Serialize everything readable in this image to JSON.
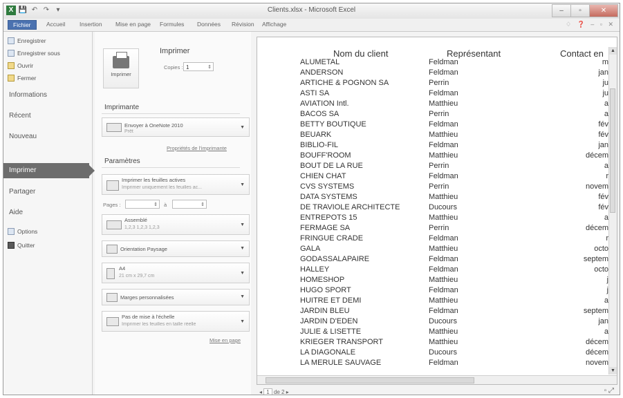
{
  "window": {
    "title": "Clients.xlsx - Microsoft Excel",
    "qat": [
      "X",
      "💾",
      "↶",
      "↷",
      "▾"
    ],
    "controls": [
      "–",
      "▫",
      "✕"
    ]
  },
  "ribbon": {
    "tabs": [
      "Fichier",
      "Accueil",
      "Insertion",
      "Mise en page",
      "Formules",
      "Données",
      "Révision",
      "Affichage"
    ],
    "right_icons": "♢ ❓ – ▫ ✕"
  },
  "nav": {
    "top_items": [
      "Enregistrer",
      "Enregistrer sous",
      "Ouvrir",
      "Fermer"
    ],
    "informations": "Informations",
    "recent": "Récent",
    "nouveau": "Nouveau",
    "imprimer": "Imprimer",
    "partager": "Partager",
    "aide": "Aide",
    "options": "Options",
    "quitter": "Quitter"
  },
  "print": {
    "heading": "Imprimer",
    "button_label": "Imprimer",
    "copies_label": "Copies :",
    "copies_value": "1",
    "printer_heading": "Imprimante",
    "printer_name": "Envoyer à OneNote 2010",
    "printer_status": "Prêt",
    "printer_props": "Propriétés de l'imprimante",
    "settings_heading": "Paramètres",
    "what_l1": "Imprimer les feuilles actives",
    "what_l2": "Imprimer uniquement les feuilles ac...",
    "pages_label": "Pages :",
    "pages_to": "à",
    "collate_l1": "Assemblé",
    "collate_l2": "1,2,3   1,2,3   1,2,3",
    "orientation": "Orientation Paysage",
    "paper_l1": "A4",
    "paper_l2": "21 cm x 29,7 cm",
    "margins": "Marges personnalisées",
    "scale_l1": "Pas de mise à l'échelle",
    "scale_l2": "Imprimer les feuilles en taille réelle",
    "page_setup": "Mise en page"
  },
  "preview": {
    "headers": [
      "Nom du client",
      "Représentant",
      "Contact en"
    ],
    "rows": [
      [
        "ALUMETAL",
        "Feldman",
        "m"
      ],
      [
        "ANDERSON",
        "Feldman",
        "jan"
      ],
      [
        "ARTICHE & POGNON SA",
        "Perrin",
        "ju"
      ],
      [
        "ASTI SA",
        "Feldman",
        "ju"
      ],
      [
        "AVIATION Intl.",
        "Matthieu",
        "a"
      ],
      [
        "BACOS SA",
        "Perrin",
        "a"
      ],
      [
        "BETTY BOUTIQUE",
        "Feldman",
        "fév"
      ],
      [
        "BEUARK",
        "Matthieu",
        "fév"
      ],
      [
        "BIBLIO-FIL",
        "Feldman",
        "jan"
      ],
      [
        "BOUFF'ROOM",
        "Matthieu",
        "décem"
      ],
      [
        "BOUT DE LA RUE",
        "Perrin",
        "a"
      ],
      [
        "CHIEN CHAT",
        "Feldman",
        "r"
      ],
      [
        "CVS SYSTEMS",
        "Perrin",
        "novem"
      ],
      [
        "DATA SYSTEMS",
        "Matthieu",
        "fév"
      ],
      [
        "DE TRAVIOLE ARCHITECTE",
        "Ducours",
        "fév"
      ],
      [
        "ENTREPOTS 15",
        "Matthieu",
        "a"
      ],
      [
        "FERMAGE SA",
        "Perrin",
        "décem"
      ],
      [
        "FRINGUE CRADE",
        "Feldman",
        "r"
      ],
      [
        "GALA",
        "Matthieu",
        "octo"
      ],
      [
        "GODASSALAPAIRE",
        "Feldman",
        "septem"
      ],
      [
        "HALLEY",
        "Feldman",
        "octo"
      ],
      [
        "HOMESHOP",
        "Matthieu",
        "j"
      ],
      [
        "HUGO SPORT",
        "Feldman",
        "j"
      ],
      [
        "HUITRE ET DEMI",
        "Matthieu",
        "a"
      ],
      [
        "JARDIN BLEU",
        "Feldman",
        "septem"
      ],
      [
        "JARDIN D'EDEN",
        "Ducours",
        "jan"
      ],
      [
        "JULIE & LISETTE",
        "Matthieu",
        "a"
      ],
      [
        "KRIEGER TRANSPORT",
        "Matthieu",
        "décem"
      ],
      [
        "LA DIAGONALE",
        "Ducours",
        "décem"
      ],
      [
        "LA MERULE SAUVAGE",
        "Feldman",
        "novem"
      ]
    ]
  },
  "status": {
    "page_current": "1",
    "page_total_label": "de 2"
  }
}
